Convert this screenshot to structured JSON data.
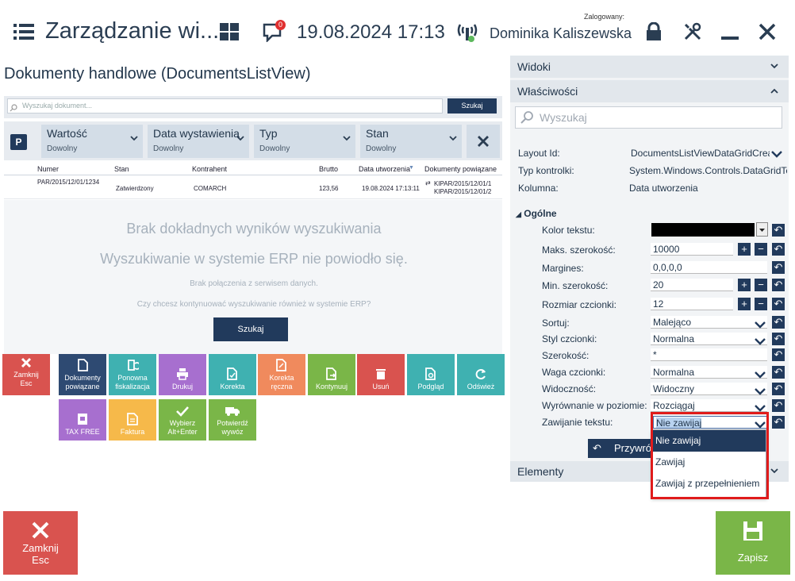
{
  "header": {
    "title": "Zarządzanie wi...",
    "notification_count": "0",
    "datetime": "19.08.2024 17:13",
    "logged_label": "Zalogowany:",
    "user_name": "Dominika Kaliszewska"
  },
  "documents": {
    "title": "Dokumenty handlowe (DocumentsListView)",
    "search_placeholder": "Wyszukaj dokument...",
    "search_button": "Szukaj",
    "filters": [
      {
        "label": "Wartość",
        "value": "Dowolny"
      },
      {
        "label": "Data wystawienia",
        "value": "Dowolny"
      },
      {
        "label": "Typ",
        "value": "Dowolny"
      },
      {
        "label": "Stan",
        "value": "Dowolny"
      }
    ],
    "filter_p": "P",
    "columns": [
      "Numer",
      "Stan",
      "Kontrahent",
      "Brutto",
      "Data utworzenia",
      "Dokumenty powiązane"
    ],
    "row": {
      "numer": "PAR/2015/12/01/1234",
      "stan": "Zatwierdzony",
      "kontrahent": "COMARCH",
      "brutto": "123,56",
      "data": "19.08.2024 17:13:11",
      "powiazane1": "KIPAR/2015/12/01/1",
      "powiazane2": "KIPAR/2015/12/01/2"
    },
    "no_results": {
      "line1": "Brak dokładnych wyników wyszukiwania",
      "line2": "Wyszukiwanie w systemie ERP nie powiodło się.",
      "line3": "Brak połączenia z serwisem danych.",
      "line4": "Czy chcesz kontynuować wyszukiwanie również w systemie ERP?",
      "button": "Szukaj"
    }
  },
  "tiles": {
    "close_l1": "Zamknij",
    "close_l2": "Esc",
    "docs_l1": "Dokumenty",
    "docs_l2": "powiązane",
    "refisk_l1": "Ponowna",
    "refisk_l2": "fiskalizacja",
    "print": "Drukuj",
    "correction": "Korekta",
    "manual_l1": "Korekta",
    "manual_l2": "ręczna",
    "continue": "Kontynuuj",
    "delete": "Usuń",
    "preview": "Podgląd",
    "refresh": "Odśwież",
    "taxfree": "TAX FREE",
    "invoice": "Faktura",
    "choose_l1": "Wybierz",
    "choose_l2": "Alt+Enter",
    "confirm_l1": "Potwierdź",
    "confirm_l2": "wywóz"
  },
  "panel": {
    "views": "Widoki",
    "properties": "Właściwości",
    "search_placeholder": "Wyszukaj",
    "layout_id_label": "Layout Id:",
    "layout_id_value": "DocumentsListViewDataGridCreate",
    "control_type_label": "Typ kontrolki:",
    "control_type_value": "System.Windows.Controls.DataGridTextColumn",
    "column_label": "Kolumna:",
    "column_value": "Data utworzenia",
    "group": "Ogólne",
    "props": {
      "text_color": "Kolor tekstu:",
      "max_width": "Maks. szerokość:",
      "max_width_val": "10000",
      "margins": "Margines:",
      "margins_val": "0,0,0,0",
      "min_width": "Min. szerokość:",
      "min_width_val": "20",
      "font_size": "Rozmiar czcionki:",
      "font_size_val": "12",
      "sort": "Sortuj:",
      "sort_val": "Malejąco",
      "font_style": "Styl czcionki:",
      "font_style_val": "Normalna",
      "width": "Szerokość:",
      "width_val": "*",
      "font_weight": "Waga czcionki:",
      "font_weight_val": "Normalna",
      "visibility": "Widoczność:",
      "visibility_val": "Widoczny",
      "h_align": "Wyrównanie w poziomie:",
      "h_align_val": "Rozciągaj",
      "wrap": "Zawijanie tekstu:",
      "wrap_val": "Nie zawijaj"
    },
    "restore_button": "Przywróć",
    "elements": "Elementy",
    "wrap_options": [
      "Nie zawijaj",
      "Zawijaj",
      "Zawijaj z przepełnieniem"
    ]
  },
  "footer": {
    "close_l1": "Zamknij",
    "close_l2": "Esc",
    "save": "Zapisz"
  },
  "colors": {
    "navy": "#213a5c",
    "red": "#d9534f",
    "green": "#7ab648",
    "highlight": "#e01b1b"
  }
}
